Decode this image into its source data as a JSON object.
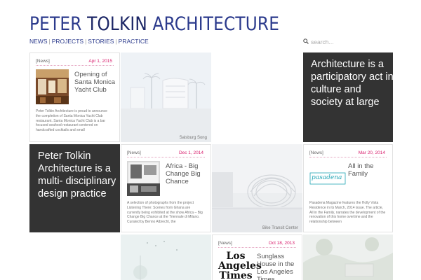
{
  "brand": {
    "word1": "PETER",
    "word2": "TOLKIN",
    "word3": "ARCHITECTURE"
  },
  "nav": {
    "items": [
      "NEWS",
      "PROJECTS",
      "STORIES",
      "PRACTICE"
    ],
    "separator": "|"
  },
  "search": {
    "placeholder": "search..."
  },
  "statements": {
    "s1": "Architecture is a participatory act in culture and society at large",
    "s2": "Peter Tolkin Architecture is a multi- disciplinary design practice"
  },
  "cards": [
    {
      "tag": "[News]",
      "date": "Apr 1, 2015",
      "title": "Opening of Santa Monica Yacht Club",
      "body": "Peter Tolkin Architecture is proud to announce the completion of Santa Monica Yacht Club restaurant. Santa Monica Yacht Club is a bar focused seafood restaurant centered on handcrafted cocktails and small"
    },
    {
      "tag": "[News]",
      "date": "Dec 1, 2014",
      "title": "Africa - Big Change Big Chance",
      "body": "A selection of photographs from the project Listening There: Scenes from Ghana are currently being exhibited at the show Africa – Big Change Big Chance at the Triennale di Milano. Curated by Benno Albrecht, the"
    },
    {
      "tag": "[News]",
      "date": "Mar 20, 2014",
      "title": "All in the Family",
      "logo": "pasadena",
      "body": "Pasadena Magazine features the Holly Vista Residence in its March, 2014 issue. The article, All in the Family, narrates the development of the renovation of this home overtime and the relationship between"
    },
    {
      "tag": "[News]",
      "date": "Oct 18, 2013",
      "title": "Sunglass House in the Los Angeles Times",
      "logo": "Los Angeles Times"
    }
  ],
  "photos": {
    "p1": "Salsburg Song",
    "p2": "Bike Transit Center"
  },
  "colors": {
    "brand_blue": "#2b3a8c",
    "accent_pink": "#d81b6b",
    "statement_bg": "#333333"
  }
}
